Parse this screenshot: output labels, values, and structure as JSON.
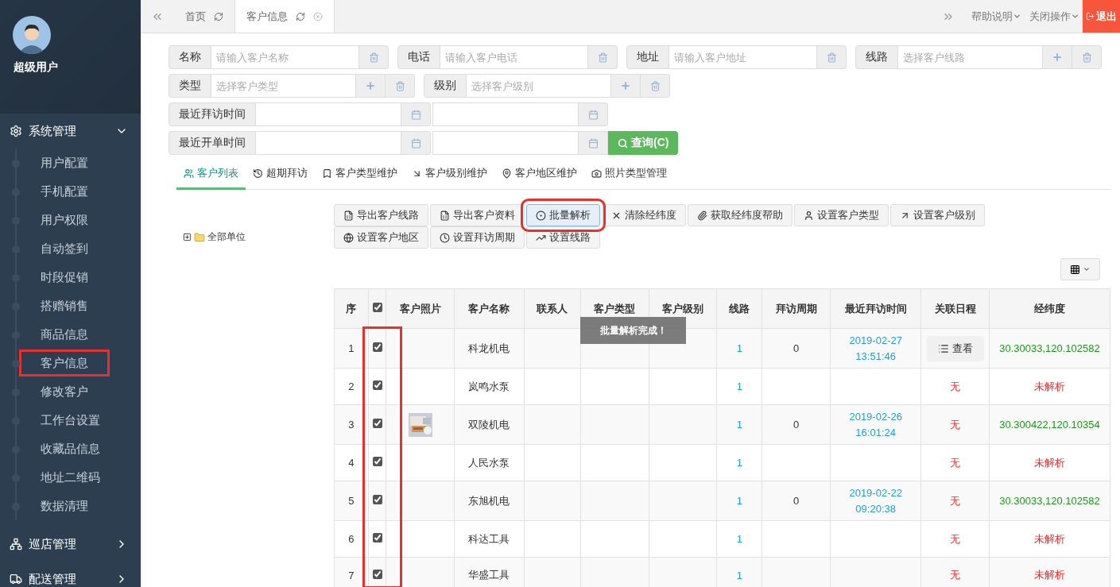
{
  "sidebar": {
    "user_name": "超级用户",
    "groups": [
      {
        "label": "系统管理",
        "expanded": true,
        "items": [
          {
            "label": "用户配置",
            "highlighted": false
          },
          {
            "label": "手机配置",
            "highlighted": false
          },
          {
            "label": "用户权限",
            "highlighted": false
          },
          {
            "label": "自动签到",
            "highlighted": false
          },
          {
            "label": "时段促销",
            "highlighted": false
          },
          {
            "label": "搭赠销售",
            "highlighted": false
          },
          {
            "label": "商品信息",
            "highlighted": false
          },
          {
            "label": "客户信息",
            "highlighted": true
          },
          {
            "label": "修改客户",
            "highlighted": false
          },
          {
            "label": "工作台设置",
            "highlighted": false
          },
          {
            "label": "收藏品信息",
            "highlighted": false
          },
          {
            "label": "地址二维码",
            "highlighted": false
          },
          {
            "label": "数据清理",
            "highlighted": false
          }
        ]
      },
      {
        "label": "巡店管理",
        "expanded": false
      },
      {
        "label": "配送管理",
        "expanded": false
      }
    ]
  },
  "page_tabs": [
    {
      "label": "首页",
      "selected": false,
      "closable": false
    },
    {
      "label": "客户信息",
      "selected": true,
      "closable": true
    }
  ],
  "top_menus": [
    "帮助说明",
    "关闭操作"
  ],
  "logout": "退出",
  "filters": [
    [
      {
        "label": "名称",
        "placeholder": "请输入客户名称",
        "add": false
      },
      {
        "label": "电话",
        "placeholder": "请输入客户电话",
        "add": false
      },
      {
        "label": "地址",
        "placeholder": "请输入客户地址",
        "add": false
      },
      {
        "label": "线路",
        "placeholder": "选择客户线路",
        "add": true
      }
    ],
    [
      {
        "label": "类型",
        "placeholder": "选择客户类型",
        "add": true
      },
      {
        "label": "级别",
        "placeholder": "选择客户级别",
        "add": true
      }
    ]
  ],
  "date_filters": [
    {
      "label": "最近拜访时间"
    },
    {
      "label": "最近开单时间"
    }
  ],
  "query_button": "查询(C)",
  "tabs": [
    {
      "label": "客户列表",
      "selected": true
    },
    {
      "label": "超期拜访",
      "selected": false
    },
    {
      "label": "客户类型维护",
      "selected": false
    },
    {
      "label": "客户级别维护",
      "selected": false
    },
    {
      "label": "客户地区维护",
      "selected": false
    },
    {
      "label": "照片类型管理",
      "selected": false
    }
  ],
  "tree": {
    "label": "全部单位",
    "expanded": false
  },
  "actions": [
    {
      "label": "导出客户线路",
      "highlighted": false
    },
    {
      "label": "导出客户资料",
      "highlighted": false
    },
    {
      "label": "批量解析",
      "highlighted": true
    },
    {
      "label": "清除经纬度",
      "highlighted": false
    },
    {
      "label": "获取经纬度帮助",
      "highlighted": false
    },
    {
      "label": "设置客户类型",
      "highlighted": false
    },
    {
      "label": "设置客户级别",
      "highlighted": false
    },
    {
      "label": "设置客户地区",
      "highlighted": false
    },
    {
      "label": "设置拜访周期",
      "highlighted": false
    },
    {
      "label": "设置线路",
      "highlighted": false
    }
  ],
  "table": {
    "columns": [
      "序",
      "客户照片",
      "客户名称",
      "联系人",
      "客户类型",
      "客户级别",
      "线路",
      "拜访周期",
      "最近拜访时间",
      "关联日程",
      "经纬度"
    ],
    "all_checked": true,
    "checkbox_column_highlighted": true,
    "rows": [
      {
        "seq": "1",
        "checked": true,
        "name": "科龙机电",
        "route": "1",
        "cycle": "0",
        "date": "2019-02-27",
        "time": "13:51:46",
        "schedule": {
          "kind": "button",
          "text": "查看"
        },
        "location": {
          "kind": "resolved",
          "text": "30.30033,120.102582"
        }
      },
      {
        "seq": "2",
        "checked": true,
        "name": "岚鸣水泵",
        "route": "1",
        "schedule": {
          "kind": "none",
          "text": "无"
        },
        "location": {
          "kind": "unresolved",
          "text": "未解析"
        }
      },
      {
        "seq": "3",
        "checked": true,
        "photo": true,
        "name": "双陵机电",
        "route": "1",
        "cycle": "0",
        "date": "2019-02-26",
        "time": "16:01:24",
        "schedule": {
          "kind": "none",
          "text": "无"
        },
        "location": {
          "kind": "resolved",
          "text": "30.300422,120.10354"
        }
      },
      {
        "seq": "4",
        "checked": true,
        "name": "人民水泵",
        "route": "1",
        "schedule": {
          "kind": "none",
          "text": "无"
        },
        "location": {
          "kind": "unresolved",
          "text": "未解析"
        }
      },
      {
        "seq": "5",
        "checked": true,
        "name": "东旭机电",
        "route": "1",
        "cycle": "0",
        "date": "2019-02-22",
        "time": "09:20:38",
        "schedule": {
          "kind": "none",
          "text": "无"
        },
        "location": {
          "kind": "resolved",
          "text": "30.30033,120.102582"
        }
      },
      {
        "seq": "6",
        "checked": true,
        "name": "科达工具",
        "route": "1",
        "schedule": {
          "kind": "none",
          "text": "无"
        },
        "location": {
          "kind": "unresolved",
          "text": "未解析"
        }
      },
      {
        "seq": "7",
        "checked": true,
        "name": "华盛工具",
        "route": "1",
        "schedule": {
          "kind": "none",
          "text": "无"
        },
        "location": {
          "kind": "unresolved",
          "text": "未解析"
        }
      }
    ]
  },
  "toast": "批量解析完成！"
}
